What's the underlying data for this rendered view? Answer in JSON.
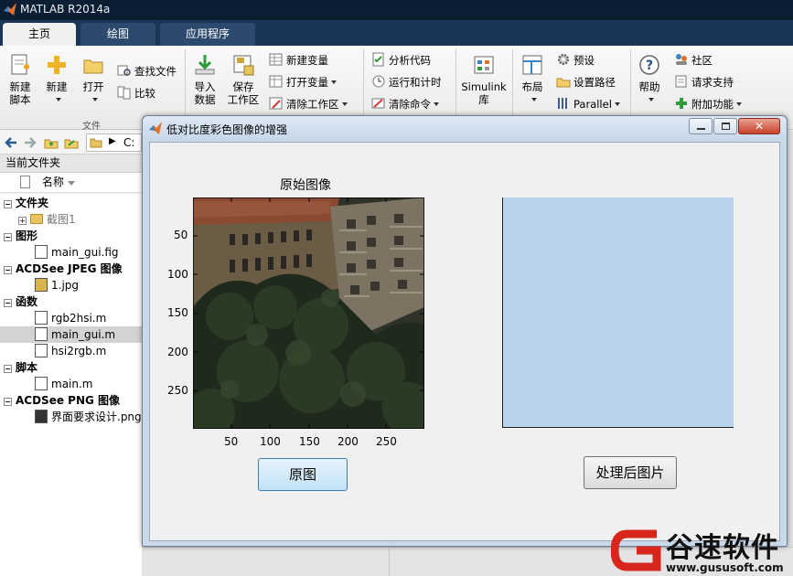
{
  "app": {
    "title": "MATLAB R2014a"
  },
  "tabs": [
    {
      "label": "主页",
      "active": true
    },
    {
      "label": "绘图",
      "active": false
    },
    {
      "label": "应用程序",
      "active": false
    }
  ],
  "ribbon": {
    "new_script": "新建\n脚本",
    "new_script_l1": "新建",
    "new_script_l2": "脚本",
    "new": "新建",
    "open": "打开",
    "find_files": "查找文件",
    "compare": "比较",
    "file_group": "文件",
    "import_l1": "导入",
    "import_l2": "数据",
    "save_ws_l1": "保存",
    "save_ws_l2": "工作区",
    "new_var": "新建变量",
    "open_var": "打开变量",
    "clear_ws": "清除工作区",
    "analyze_code": "分析代码",
    "run_time": "运行和计时",
    "clear_cmds": "清除命令",
    "simulink_l1": "Simulink",
    "simulink_l2": "库",
    "layout": "布局",
    "preferences": "预设",
    "set_path": "设置路径",
    "parallel": "Parallel",
    "help": "帮助",
    "community": "社区",
    "request_support": "请求支持",
    "addons": "附加功能"
  },
  "path": {
    "drive": "C:"
  },
  "file_browser": {
    "panel_title": "当前文件夹",
    "column_name": "名称",
    "rows": [
      {
        "type": "group",
        "label": "文件夹"
      },
      {
        "type": "folder",
        "label": "截图1"
      },
      {
        "type": "group",
        "label": "图形"
      },
      {
        "type": "file",
        "label": "main_gui.fig"
      },
      {
        "type": "group",
        "label": "ACDSee JPEG 图像"
      },
      {
        "type": "file",
        "label": "1.jpg"
      },
      {
        "type": "group",
        "label": "函数"
      },
      {
        "type": "file",
        "label": "rgb2hsi.m"
      },
      {
        "type": "file",
        "label": "main_gui.m",
        "selected": true
      },
      {
        "type": "file",
        "label": "hsi2rgb.m"
      },
      {
        "type": "group",
        "label": "脚本"
      },
      {
        "type": "file",
        "label": "main.m"
      },
      {
        "type": "group",
        "label": "ACDSee PNG 图像"
      },
      {
        "type": "file",
        "label": "界面要求设计.png"
      }
    ]
  },
  "figure": {
    "window_title": "低对比度彩色图像的增强",
    "axes1_title": "原始图像",
    "axes1_yticks": [
      "50",
      "100",
      "150",
      "200",
      "250"
    ],
    "axes1_xticks": [
      "50",
      "100",
      "150",
      "200",
      "250"
    ],
    "btn_original": "原图",
    "btn_processed": "处理后图片",
    "axes2_color": "#b9d3ee"
  },
  "watermark": {
    "brand": "谷速软件",
    "url": "www.gususoft.com"
  }
}
